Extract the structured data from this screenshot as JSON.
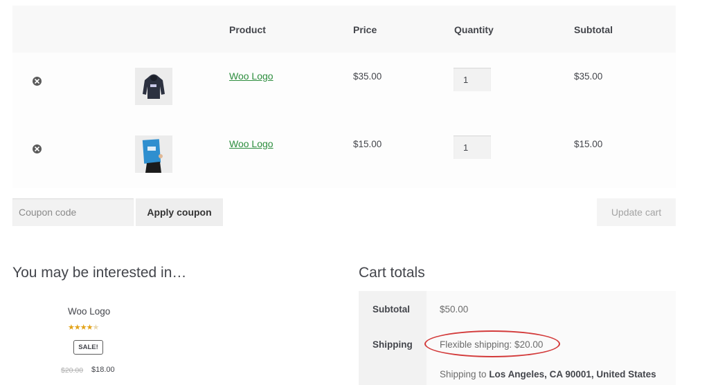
{
  "cart_table": {
    "headers": {
      "product": "Product",
      "price": "Price",
      "quantity": "Quantity",
      "subtotal": "Subtotal"
    },
    "rows": [
      {
        "name": "Woo Logo",
        "price": "$35.00",
        "quantity": "1",
        "subtotal": "$35.00",
        "thumbnail": "hoodie"
      },
      {
        "name": "Woo Logo",
        "price": "$15.00",
        "quantity": "1",
        "subtotal": "$15.00",
        "thumbnail": "poster"
      }
    ],
    "remove_icon": "close-circle-icon"
  },
  "coupon": {
    "placeholder": "Coupon code",
    "apply_label": "Apply coupon"
  },
  "update_cart_label": "Update cart",
  "recommendations": {
    "title": "You may be interested in…",
    "item": {
      "name": "Woo Logo",
      "rating": 4,
      "rating_max": 5,
      "badge": "Sale!",
      "old_price": "$20.00",
      "new_price": "$18.00"
    }
  },
  "cart_totals": {
    "title": "Cart totals",
    "subtotal_label": "Subtotal",
    "subtotal_value": "$50.00",
    "shipping_label": "Shipping",
    "shipping_method": "Flexible shipping: $20.00",
    "shipping_to_prefix": "Shipping to ",
    "shipping_to_location": "Los Angeles, CA 90001, United States"
  },
  "colors": {
    "link": "#2c8d3d",
    "star": "#e3a319",
    "highlight_ellipse": "#d33a3a"
  }
}
